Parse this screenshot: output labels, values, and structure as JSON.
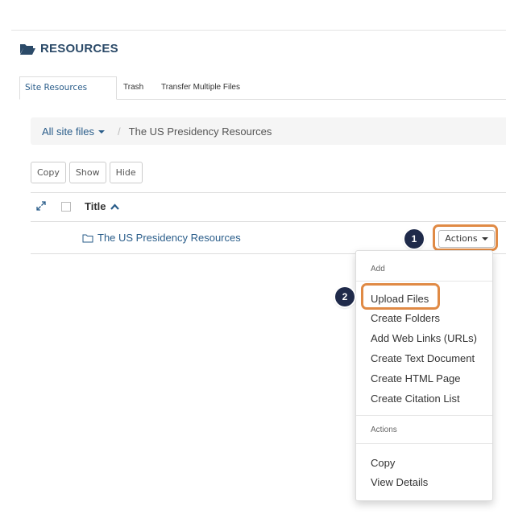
{
  "header": {
    "title": "RESOURCES",
    "icon": "folder-open-icon",
    "color": "#2b4a68"
  },
  "tabs": [
    {
      "label": "Site Resources",
      "active": true
    },
    {
      "label": "Trash",
      "active": false
    },
    {
      "label": "Transfer Multiple Files",
      "active": false
    }
  ],
  "breadcrumb": {
    "root": "All site files",
    "separator": "/",
    "current": "The US Presidency Resources"
  },
  "toolbar": {
    "copy": "Copy",
    "show": "Show",
    "hide": "Hide"
  },
  "table": {
    "column_title": "Title",
    "rows": [
      {
        "name": "The US Presidency Resources",
        "type": "folder"
      }
    ]
  },
  "actions_button": {
    "label": "Actions"
  },
  "callouts": {
    "step1": "1",
    "step2": "2",
    "highlight_color": "#e08a45"
  },
  "menu": {
    "section1_header": "Add",
    "add_items": [
      "Upload Files",
      "Create Folders",
      "Add Web Links (URLs)",
      "Create Text Document",
      "Create HTML Page",
      "Create Citation List"
    ],
    "section2_header": "Actions",
    "action_items": [
      "Copy",
      "View Details"
    ]
  },
  "colors": {
    "link": "#2a5d8a",
    "callout_bg": "#1f2a4a"
  }
}
